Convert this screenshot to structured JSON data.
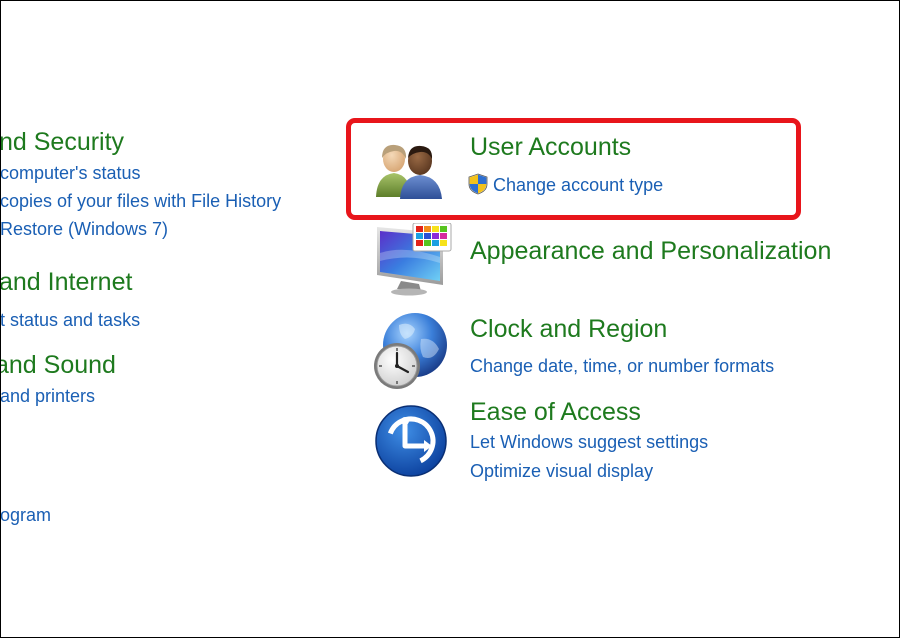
{
  "left_column": {
    "system_security": {
      "title": "nd Security",
      "links": [
        "computer's status",
        "copies of your files with File History",
        "Restore (Windows 7)"
      ]
    },
    "network_internet": {
      "title": "and Internet",
      "links": [
        "t status and tasks"
      ]
    },
    "hardware_sound": {
      "title": " and Sound",
      "links": [
        "and printers"
      ]
    },
    "programs": {
      "links": [
        "ogram"
      ]
    }
  },
  "right_column": {
    "user_accounts": {
      "title": "User Accounts",
      "links": [
        "Change account type"
      ]
    },
    "appearance": {
      "title": "Appearance and Personalization"
    },
    "clock_region": {
      "title": "Clock and Region",
      "links": [
        "Change date, time, or number formats"
      ]
    },
    "ease_access": {
      "title": "Ease of Access",
      "links": [
        "Let Windows suggest settings",
        "Optimize visual display"
      ]
    }
  },
  "icons": {
    "user_accounts": "users-icon",
    "uac": "uac-shield-icon",
    "appearance": "monitor-palette-icon",
    "clock_region": "globe-clock-icon",
    "ease_access": "ease-of-access-icon"
  },
  "colors": {
    "category_title": "#1e7a1e",
    "link": "#1a5fb4",
    "highlight": "#e8151b"
  }
}
